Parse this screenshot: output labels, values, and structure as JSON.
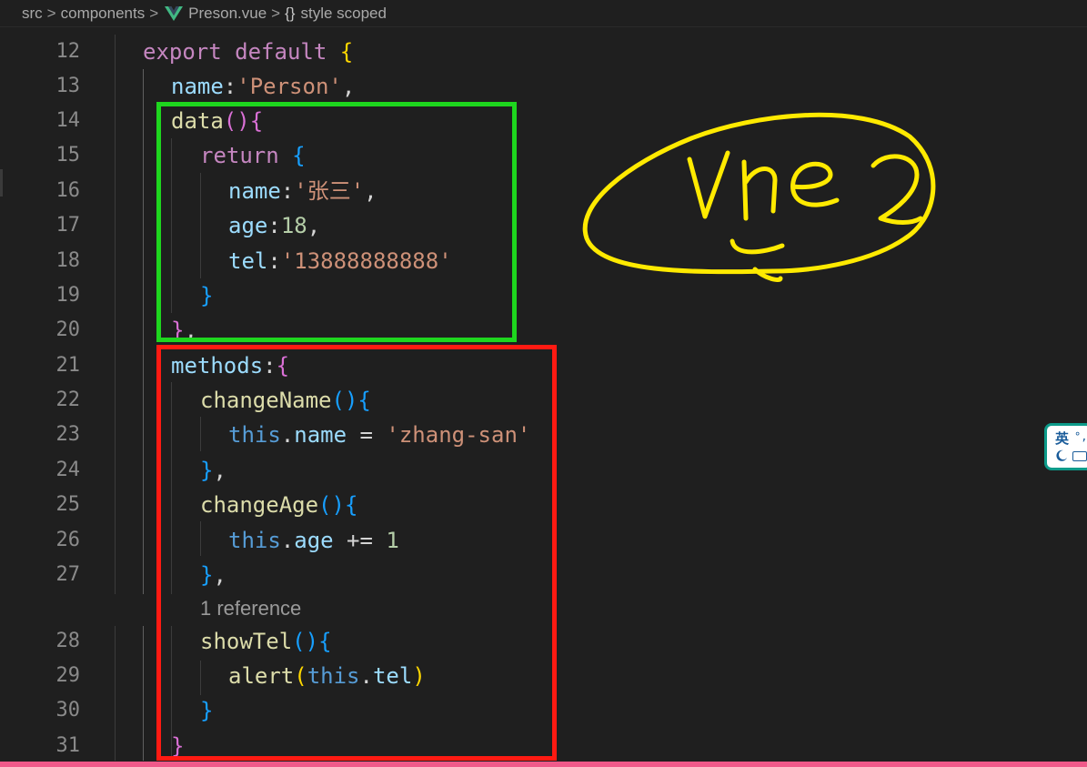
{
  "breadcrumb": {
    "src": "src",
    "components": "components",
    "file": "Preson.vue",
    "braces": "{}",
    "section": "style scoped"
  },
  "colors": {
    "background": "#1f1f1f",
    "keyword": "#c586c0",
    "brace_gold": "#ffd700",
    "brace_purple": "#da70d6",
    "brace_blue": "#179fff",
    "property": "#9cdcfe",
    "function": "#dcdcaa",
    "string": "#ce9178",
    "number": "#b5cea8",
    "this": "#569cd6",
    "plain": "#d4d4d4",
    "green_box": "#1ed61e",
    "red_box": "#ff1a12",
    "annotation": "#ffea00"
  },
  "code_lens": "1 reference",
  "lines": [
    {
      "n": "12",
      "tokens": [
        [
          "export",
          "#c586c0"
        ],
        [
          " ",
          "#d4d4d4"
        ],
        [
          "default",
          "#c586c0"
        ],
        [
          " ",
          "#d4d4d4"
        ],
        [
          "{",
          "#ffd700"
        ]
      ]
    },
    {
      "n": "13",
      "tokens": [
        [
          "name",
          "#9cdcfe"
        ],
        [
          ":",
          "#d4d4d4"
        ],
        [
          "'Person'",
          "#ce9178"
        ],
        [
          ",",
          "#d4d4d4"
        ]
      ]
    },
    {
      "n": "14",
      "tokens": [
        [
          "data",
          "#dcdcaa"
        ],
        [
          "()",
          "#da70d6"
        ],
        [
          "{",
          "#da70d6"
        ]
      ]
    },
    {
      "n": "15",
      "tokens": [
        [
          "return",
          "#c586c0"
        ],
        [
          " ",
          "#d4d4d4"
        ],
        [
          "{",
          "#179fff"
        ]
      ]
    },
    {
      "n": "16",
      "tokens": [
        [
          "name",
          "#9cdcfe"
        ],
        [
          ":",
          "#d4d4d4"
        ],
        [
          "'张三'",
          "#ce9178"
        ],
        [
          ",",
          "#d4d4d4"
        ]
      ]
    },
    {
      "n": "17",
      "tokens": [
        [
          "age",
          "#9cdcfe"
        ],
        [
          ":",
          "#d4d4d4"
        ],
        [
          "18",
          "#b5cea8"
        ],
        [
          ",",
          "#d4d4d4"
        ]
      ]
    },
    {
      "n": "18",
      "tokens": [
        [
          "tel",
          "#9cdcfe"
        ],
        [
          ":",
          "#d4d4d4"
        ],
        [
          "'13888888888'",
          "#ce9178"
        ]
      ]
    },
    {
      "n": "19",
      "tokens": [
        [
          "}",
          "#179fff"
        ]
      ]
    },
    {
      "n": "20",
      "tokens": [
        [
          "}",
          "#da70d6"
        ],
        [
          ",",
          "#d4d4d4"
        ]
      ]
    },
    {
      "n": "21",
      "tokens": [
        [
          "methods",
          "#9cdcfe"
        ],
        [
          ":",
          "#d4d4d4"
        ],
        [
          "{",
          "#da70d6"
        ]
      ]
    },
    {
      "n": "22",
      "tokens": [
        [
          "changeName",
          "#dcdcaa"
        ],
        [
          "()",
          "#179fff"
        ],
        [
          "{",
          "#179fff"
        ]
      ]
    },
    {
      "n": "23",
      "tokens": [
        [
          "this",
          "#569cd6"
        ],
        [
          ".",
          "#d4d4d4"
        ],
        [
          "name",
          "#9cdcfe"
        ],
        [
          " = ",
          "#d4d4d4"
        ],
        [
          "'zhang-san'",
          "#ce9178"
        ]
      ]
    },
    {
      "n": "24",
      "tokens": [
        [
          "}",
          "#179fff"
        ],
        [
          ",",
          "#d4d4d4"
        ]
      ]
    },
    {
      "n": "25",
      "tokens": [
        [
          "changeAge",
          "#dcdcaa"
        ],
        [
          "()",
          "#179fff"
        ],
        [
          "{",
          "#179fff"
        ]
      ]
    },
    {
      "n": "26",
      "tokens": [
        [
          "this",
          "#569cd6"
        ],
        [
          ".",
          "#d4d4d4"
        ],
        [
          "age",
          "#9cdcfe"
        ],
        [
          " += ",
          "#d4d4d4"
        ],
        [
          "1",
          "#b5cea8"
        ]
      ]
    },
    {
      "n": "27",
      "tokens": [
        [
          "}",
          "#179fff"
        ],
        [
          ",",
          "#d4d4d4"
        ]
      ]
    },
    {
      "n": "28",
      "tokens": [
        [
          "showTel",
          "#dcdcaa"
        ],
        [
          "()",
          "#179fff"
        ],
        [
          "{",
          "#179fff"
        ]
      ]
    },
    {
      "n": "29",
      "tokens": [
        [
          "alert",
          "#dcdcaa"
        ],
        [
          "(",
          "#ffd700"
        ],
        [
          "this",
          "#569cd6"
        ],
        [
          ".",
          "#d4d4d4"
        ],
        [
          "tel",
          "#9cdcfe"
        ],
        [
          ")",
          "#ffd700"
        ]
      ]
    },
    {
      "n": "30",
      "tokens": [
        [
          "}",
          "#179fff"
        ]
      ]
    },
    {
      "n": "31",
      "tokens": [
        [
          "}",
          "#da70d6"
        ]
      ]
    }
  ],
  "annotation_text": "vue2",
  "ime": {
    "lang": "英",
    "dots": "°,"
  }
}
